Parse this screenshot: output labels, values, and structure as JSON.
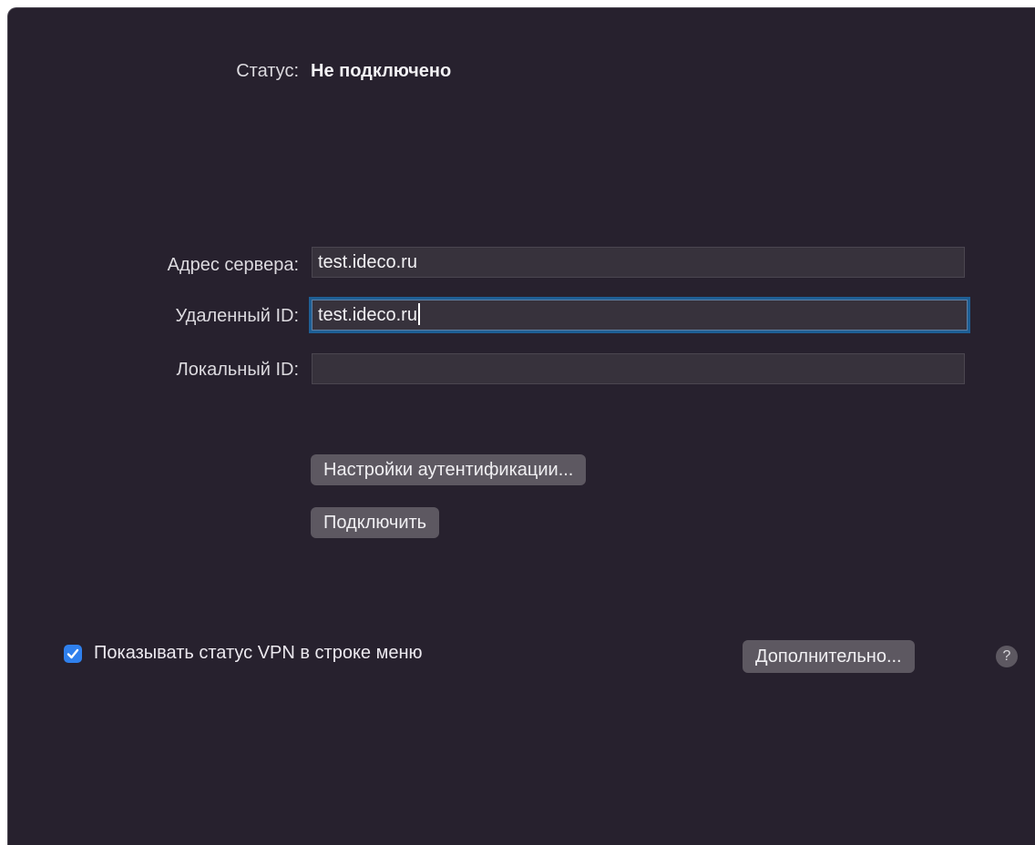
{
  "status": {
    "label": "Статус:",
    "value": "Не подключено"
  },
  "fields": [
    {
      "label": "Адрес сервера:",
      "value": "test.ideco.ru"
    },
    {
      "label": "Удаленный ID:",
      "value": "test.ideco.ru"
    },
    {
      "label": "Локальный ID:",
      "value": ""
    }
  ],
  "buttons": {
    "auth_settings": "Настройки аутентификации...",
    "connect": "Подключить",
    "advanced": "Дополнительно...",
    "help": "?"
  },
  "show_status_checkbox": {
    "label": "Показывать статус VPN в строке меню",
    "checked": true
  },
  "colors": {
    "background": "#27212e",
    "accent": "#2f80ed",
    "focus_ring": "#1e5f95"
  }
}
